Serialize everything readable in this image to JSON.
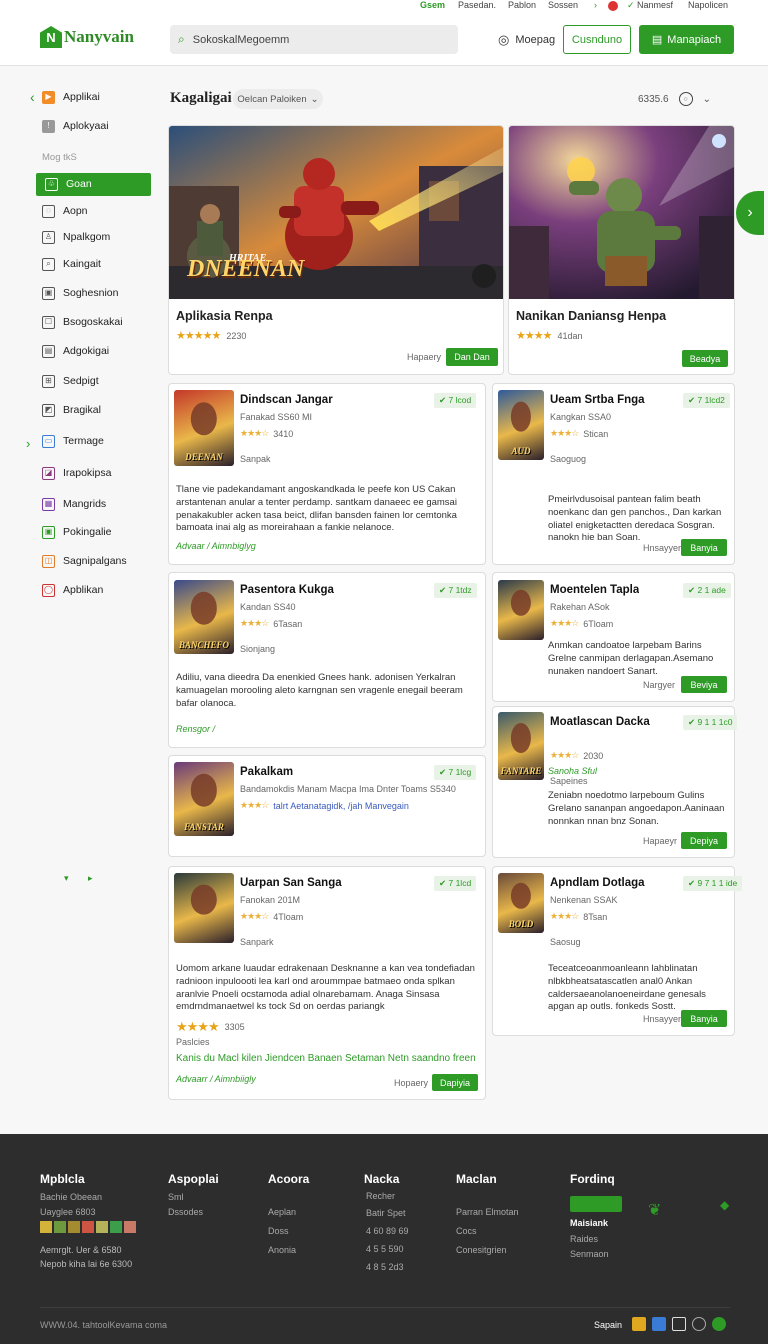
{
  "topbar": {
    "links": [
      "Gsem",
      "Pasedan.",
      "Pablon",
      "Sossen",
      "Nanmesf",
      "Napolicen"
    ]
  },
  "header": {
    "logo": "Nanyvain",
    "search_placeholder": "SokoskalMegoemm",
    "mode_label": "Moepag",
    "login_label": "Cusnduno",
    "signup_label": "Manapiach"
  },
  "sidebar": {
    "top_items": [
      "Applikai",
      "Aplokyaai"
    ],
    "section_label": "Mog tkS",
    "items": [
      "Goan",
      "Aopn",
      "Npalkgom",
      "Kaingait",
      "Soghesnion",
      "Bsogoskakai",
      "Adgokigai",
      "Sedpigt",
      "Bragikal",
      "Termage",
      "Irapokipsa",
      "Mangrids",
      "Pokingalie",
      "Sagnipalgans",
      "Apblikan"
    ]
  },
  "main": {
    "heading": "Kagaligai",
    "filter_label": "Oelcan Paloiken",
    "count_label": "6335.6"
  },
  "featured": [
    {
      "name": "Aplikasia Renpa",
      "banner_text": "DNEENAN",
      "rating_count": "2230",
      "badge": "",
      "button": "Dan Dan"
    },
    {
      "name": "Nanikan Daniansg Henpa",
      "banner_text": "",
      "rating_count": "41dan",
      "badge": "Hapaery",
      "button": "Beadya"
    }
  ],
  "apps": [
    {
      "name": "Dindscan Jangar",
      "meta": "Fanakad SS60 MI",
      "rating": "3410",
      "cat_tag": "Sanpak",
      "verify": "7 lcod",
      "desc": "Tlane vie padekandamant angoskandkada le peefe kon US Cakan arstantenan anular a tenter perdamp. santkam danaeec ee gamsai penakakubler acken tasa beict, dlifan bansden fainen lor cemtonka bamoata inai alg as moreirahaan a fankie nelanoce.",
      "category": "Advaar / Aimnbiglyg",
      "hapery": "",
      "button": "",
      "thumb_text": "DEENAN"
    },
    {
      "name": "Ueam Srtba Fnga",
      "meta": "Kangkan SSA0",
      "rating": "Stican",
      "cat_tag": "Saoguog",
      "verify": "7 1lcd2",
      "desc": "Pmeirlvdusoisal pantean falim beath noenkanc dan gen panchos., Dan karkan oliatel enigketactten deredaca Sosgran. nanokn hie ban Soan.",
      "category": "",
      "hapery": "Hnsayyer",
      "button": "Banyia",
      "thumb_text": "AUD"
    },
    {
      "name": "Pasentora Kukga",
      "meta": "Kandan SS40",
      "rating": "6Tasan",
      "cat_tag": "Sionjang",
      "verify": "7 1tdz",
      "desc": "Adiliu, vana dieedra Da enenkied Gnees hank. adonisen Yerkalran kamuagelan morooling aleto karngnan sen vragenle enegail beeram bafar olanoca.",
      "category": "Rensgor /",
      "hapery": "",
      "button": "",
      "thumb_text": "BANCHEFO"
    },
    {
      "name": "Moentelen Tapla",
      "meta": "Rakehan ASok",
      "rating": "6Tloam",
      "cat_tag": "",
      "verify": "2 1 ade",
      "desc": "Anmkan candoatoe larpebam Barins Grelne canmipan derlagapan.Asemano nunaken nandoert Sanart.",
      "category": "",
      "hapery": "Nargyer",
      "button": "Beviya",
      "thumb_text": ""
    },
    {
      "name": "Moatlascan Dacka",
      "meta": "",
      "rating": "2030",
      "cat_tag": "Sapeines",
      "verify": "9 1 1 1c0",
      "desc": "Zeniabn noedotmo larpeboum Gulins Grelano sananpan angoedapon.Aaninaan nonnkan nnan bnz Sonan.",
      "category": "Sanoha Sful",
      "hapery": "Hapaeyr",
      "button": "Depiya",
      "thumb_text": "FANTARE"
    },
    {
      "name": "Pakalkam",
      "meta": "Bandamokdis Manam Macpa Ima Dnter Toams S5340",
      "rating": "talrt Aetanatagidk, /jah Manvegain",
      "cat_tag": "",
      "verify": "7 1lcg",
      "desc": "",
      "category": "",
      "hapery": "",
      "button": "",
      "thumb_text": "FANSTAR"
    },
    {
      "name": "Uarpan San Sanga",
      "meta": "Fanokan 201M",
      "rating": "4Tloam",
      "cat_tag": "Sanpark",
      "verify": "7 1lcd",
      "desc": "Uomom arkane luaudar edrakenaan Desknanne a kan vea tondefiadan radnioon inpuloooti lea karl ond aroummpae batmaeo onda splkan aranlvie Pnoeli ocstamoda adial olnarebamam. Anaga Sinsasa emdrndmanaetwel ks tock Sd on oerdas pariangk",
      "category": "Advaarr / Aimnbiigly",
      "hapery": "Hopaery",
      "button": "Dapiyia",
      "thumb_text": "",
      "rating2": "3305",
      "sub2": "Paslcies",
      "green_line": "Kanis du Macl kilen Jiendcen Banaen Setaman Netn saandno freen"
    },
    {
      "name": "Apndlam Dotlaga",
      "meta": "Nenkenan SSAK",
      "rating": "8Tsan",
      "cat_tag": "Saosug",
      "verify": "9 7 1 1 ide",
      "desc": "Teceatceoanmoanleann lahblinatan nlbkbheatsatascatlen anal0 Ankan caldersaeanolanoeneirdane genesals apgan ap outls. fonkeds Sostt.",
      "category": "",
      "hapery": "Hnsayyer",
      "button": "Banyia",
      "thumb_text": "BOLD"
    }
  ],
  "footer": {
    "cols": [
      {
        "title": "Mpblcla",
        "links": [
          "Bachie Obeean",
          "Uayglee 6803"
        ]
      },
      {
        "title": "Aspoplai",
        "links": [
          "Sml",
          "Dssodes"
        ]
      },
      {
        "title": "Acoora",
        "links": [
          "Aeplan",
          "Doss",
          "Anonia"
        ]
      },
      {
        "title": "Nacka",
        "links": [
          "Recher",
          "Batir Spet",
          "4 60 89 69",
          "4 5 5 590",
          "4 8 5 2d3"
        ]
      },
      {
        "title": "Maclan",
        "links": [
          "Parran Elmotan",
          "Cocs",
          "Conesitgrien"
        ]
      },
      {
        "title": "Fordinq",
        "links": [
          "Maisiank",
          "Raides",
          "Senmaon"
        ]
      }
    ],
    "contact": [
      "Aemrglt. Uer & 6580",
      "Nepob kiha lai 6e 6300"
    ],
    "copyright": "WWW.04. tahtoolKevama coma",
    "social_label": "Sapain"
  },
  "colors": {
    "brand": "#2e9b27",
    "star": "#e8a317",
    "footer": "#2d2d2d"
  }
}
